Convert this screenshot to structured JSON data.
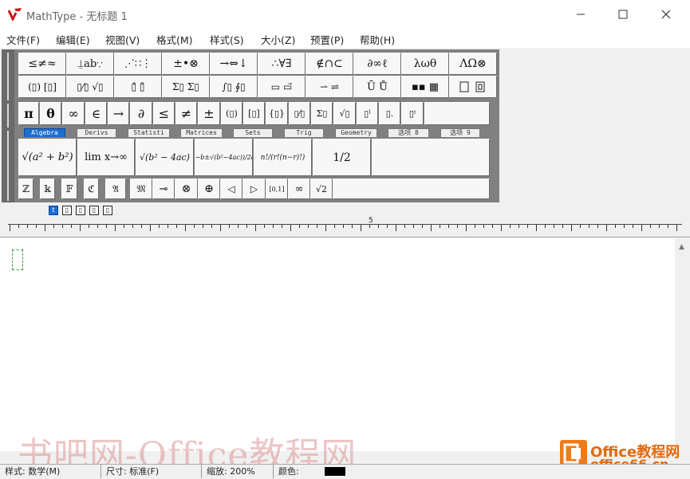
{
  "window": {
    "title": "MathType - 无标题 1"
  },
  "menu": [
    "文件(F)",
    "编辑(E)",
    "视图(V)",
    "格式(M)",
    "样式(S)",
    "大小(Z)",
    "预置(P)",
    "帮助(H)"
  ],
  "toolbar": {
    "row1": [
      "≤≠≈",
      "⍊ab∵",
      "⋰∷⋮",
      "±•⊗",
      "→⇔↓",
      "∴∀∃",
      "∉∩⊂",
      "∂∞ℓ",
      "λωθ",
      "ΛΩ⊗"
    ],
    "row2": [
      "(▯) [▯]",
      "▯⁄▯ √▯",
      "▯̂ ▯̃",
      "Σ▯ Σ▯",
      "∫▯ ∮▯",
      "▭ ▭⃗",
      "⇀ ⇌",
      "Ū Ů",
      "▪▪ ▦"
    ],
    "row3": [
      "π",
      "θ",
      "∞",
      "∈",
      "→",
      "∂",
      "≤",
      "≠",
      "±",
      "(▯)",
      "[▯]",
      "{▯}",
      "▯⁄▯",
      "Σ▯",
      "√▯",
      "▯ˡ",
      "▯.",
      "▯ⁱ"
    ],
    "tabs": [
      "Algebra",
      "Derivs",
      "Statisti",
      "Matrices",
      "Sets",
      "Trig",
      "Geometry",
      "选项 8",
      "选项 9"
    ],
    "templates": [
      "√(a² + b²)",
      "lim x→∞",
      "√(b² − 4ac)",
      "(−b±√(b²−4ac))/2a",
      "n!/(r!(n−r)!)",
      "1/2"
    ],
    "row5": [
      "ℤ",
      "𝕜",
      "𝔽",
      "ℭ",
      "𝔄",
      "𝔐",
      "⊸",
      "⊗",
      "⊕",
      "◁",
      "▷",
      "[0,1]",
      "∞",
      "√2"
    ],
    "mini": [
      "t",
      "▯",
      "▯",
      "▯",
      "▯"
    ]
  },
  "ruler": {
    "label": "5"
  },
  "status": {
    "style_label": "样式:",
    "style_value": "数学(M)",
    "size_label": "尺寸:",
    "size_value": "标准(F)",
    "zoom_label": "缩放:",
    "zoom_value": "200%",
    "color_label": "颜色:"
  },
  "watermark": {
    "left": "书吧网-Office教程网",
    "right1": "Office教程网",
    "right2": "office66.cn"
  },
  "colors": {
    "accent": "#1a6fd0",
    "logo": "#e01010",
    "watermark": "#e06a10"
  }
}
